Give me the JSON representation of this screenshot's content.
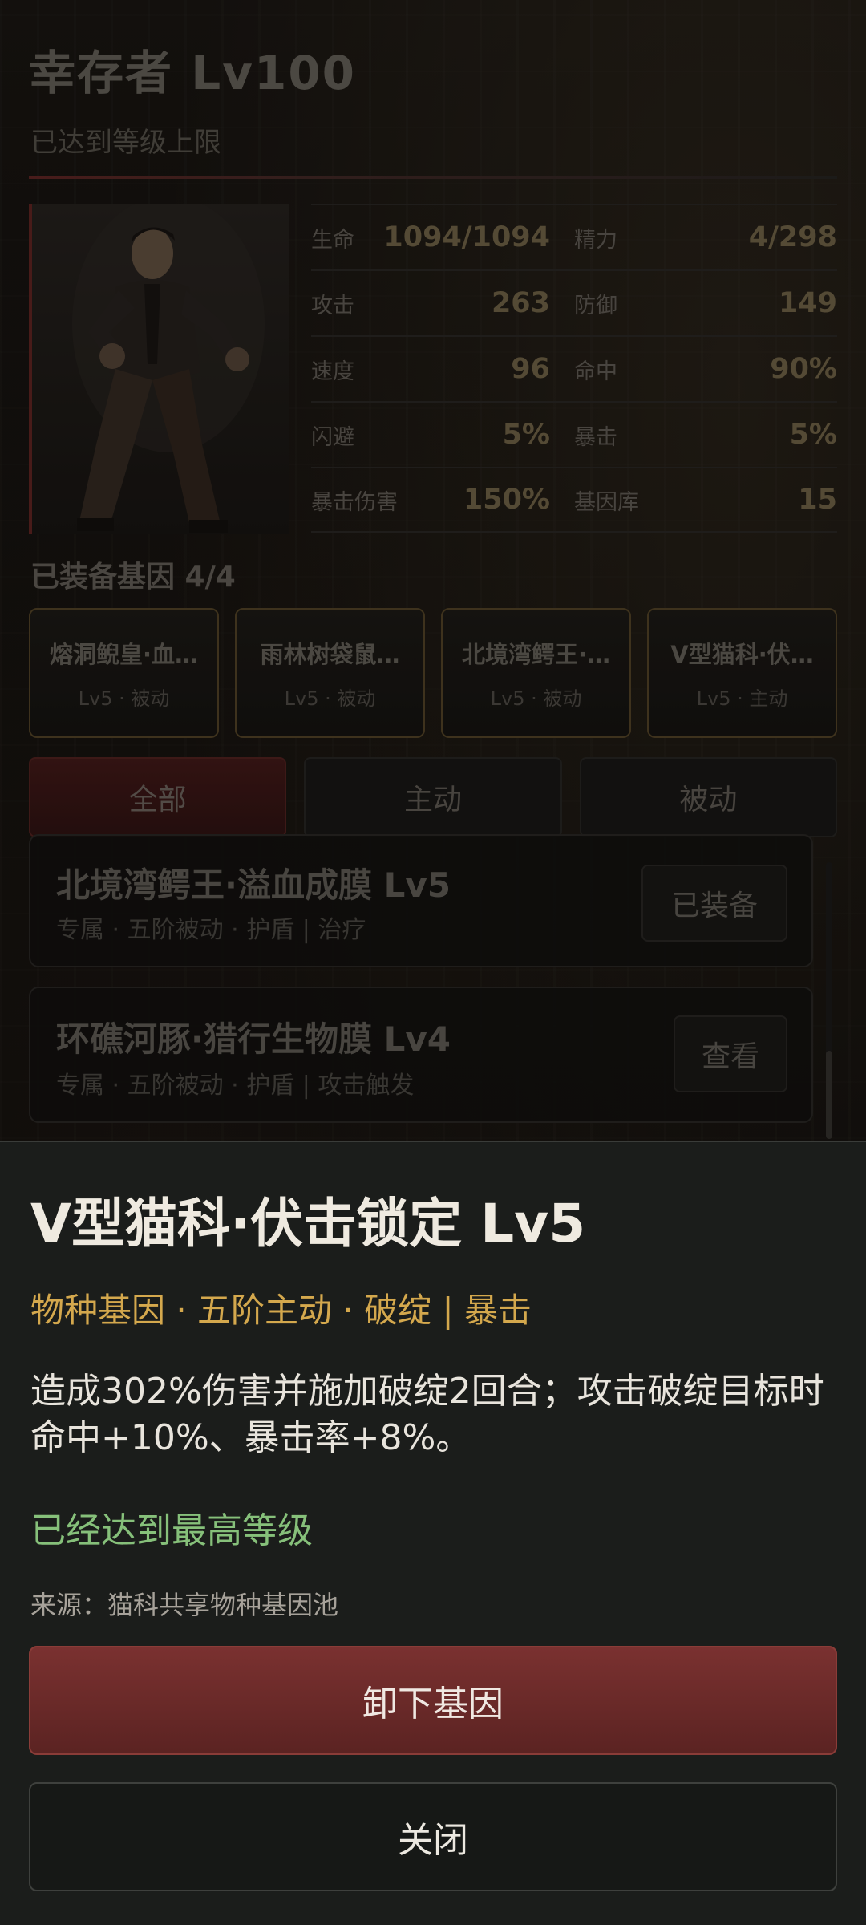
{
  "header": {
    "title": "幸存者 Lv100",
    "subtitle": "已达到等级上限"
  },
  "stats": [
    {
      "label": "生命",
      "value": "1094/1094"
    },
    {
      "label": "精力",
      "value": "4/298"
    },
    {
      "label": "攻击",
      "value": "263"
    },
    {
      "label": "防御",
      "value": "149"
    },
    {
      "label": "速度",
      "value": "96"
    },
    {
      "label": "命中",
      "value": "90%"
    },
    {
      "label": "闪避",
      "value": "5%"
    },
    {
      "label": "暴击",
      "value": "5%"
    },
    {
      "label": "暴击伤害",
      "value": "150%"
    },
    {
      "label": "基因库",
      "value": "15"
    }
  ],
  "equipped": {
    "title": "已装备基因 4/4",
    "genes": [
      {
        "name": "熔洞鲵皇·血…",
        "level": "Lv5 · 被动"
      },
      {
        "name": "雨林树袋鼠…",
        "level": "Lv5 · 被动"
      },
      {
        "name": "北境湾鳄王·…",
        "level": "Lv5 · 被动"
      },
      {
        "name": "V型猫科·伏…",
        "level": "Lv5 · 主动"
      }
    ]
  },
  "tabs": [
    {
      "label": "全部",
      "active": true
    },
    {
      "label": "主动",
      "active": false
    },
    {
      "label": "被动",
      "active": false
    }
  ],
  "gene_list": [
    {
      "title": "北境湾鳄王·溢血成膜 Lv5",
      "sub": "专属 · 五阶被动 · 护盾 | 治疗",
      "button": "已装备"
    },
    {
      "title": "环礁河豚·猎行生物膜 Lv4",
      "sub": "专属 · 五阶被动 · 护盾 | 攻击触发",
      "button": "查看"
    }
  ],
  "detail": {
    "title": "V型猫科·伏击锁定 Lv5",
    "tags": "物种基因 · 五阶主动 · 破绽 | 暴击",
    "description": "造成302%伤害并施加破绽2回合；攻击破绽目标时命中+10%、暴击率+8%。",
    "status": "已经达到最高等级",
    "source": "来源：猫科共享物种基因池",
    "unequip_label": "卸下基因",
    "close_label": "关闭"
  },
  "colors": {
    "accent_red": "#7a3130",
    "tag_gold": "#d4a84d",
    "status_green": "#86c07a"
  }
}
